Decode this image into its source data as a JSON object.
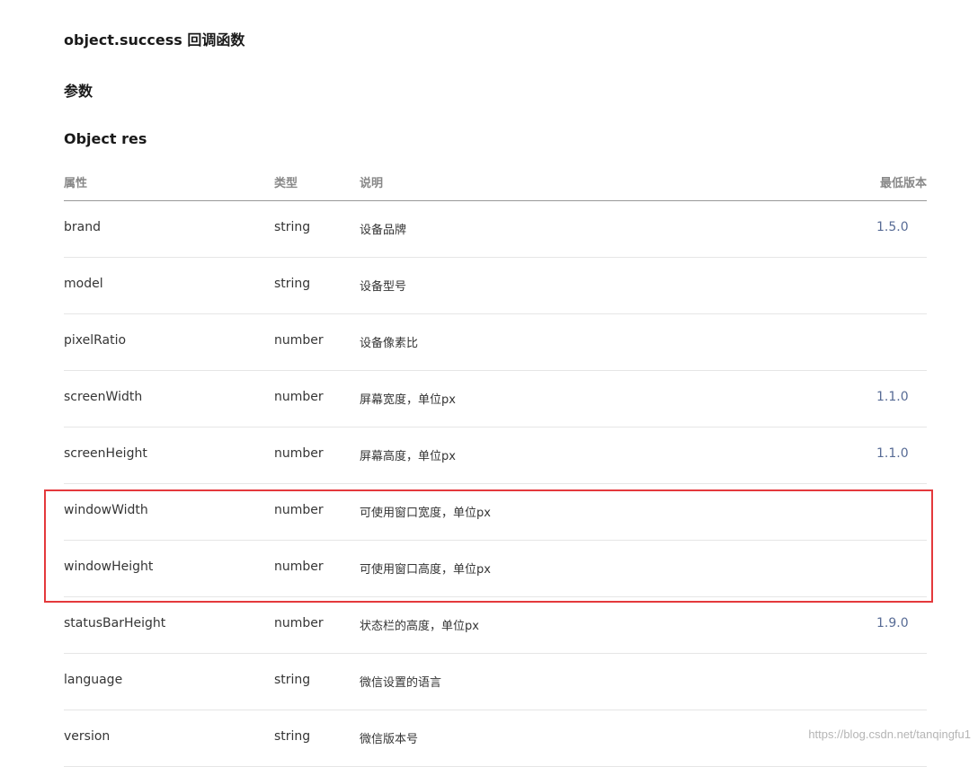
{
  "headings": {
    "success_title": "object.success 回调函数",
    "params_title": "参数",
    "object_title": "Object res"
  },
  "table": {
    "columns": [
      "属性",
      "类型",
      "说明",
      "最低版本"
    ],
    "rows": [
      {
        "name": "brand",
        "type": "string",
        "desc": "设备品牌",
        "version": "1.5.0"
      },
      {
        "name": "model",
        "type": "string",
        "desc": "设备型号",
        "version": ""
      },
      {
        "name": "pixelRatio",
        "type": "number",
        "desc": "设备像素比",
        "version": ""
      },
      {
        "name": "screenWidth",
        "type": "number",
        "desc": "屏幕宽度，单位px",
        "version": "1.1.0"
      },
      {
        "name": "screenHeight",
        "type": "number",
        "desc": "屏幕高度，单位px",
        "version": "1.1.0"
      },
      {
        "name": "windowWidth",
        "type": "number",
        "desc": "可使用窗口宽度，单位px",
        "version": ""
      },
      {
        "name": "windowHeight",
        "type": "number",
        "desc": "可使用窗口高度，单位px",
        "version": ""
      },
      {
        "name": "statusBarHeight",
        "type": "number",
        "desc": "状态栏的高度，单位px",
        "version": "1.9.0"
      },
      {
        "name": "language",
        "type": "string",
        "desc": "微信设置的语言",
        "version": ""
      },
      {
        "name": "version",
        "type": "string",
        "desc": "微信版本号",
        "version": ""
      }
    ]
  },
  "highlight": {
    "color": "#e4393c",
    "rows": [
      "windowWidth",
      "windowHeight"
    ]
  },
  "colors": {
    "version_link": "#576b95",
    "header_text": "#888888",
    "body_text": "#353535"
  },
  "watermark": "https://blog.csdn.net/tanqingfu1"
}
